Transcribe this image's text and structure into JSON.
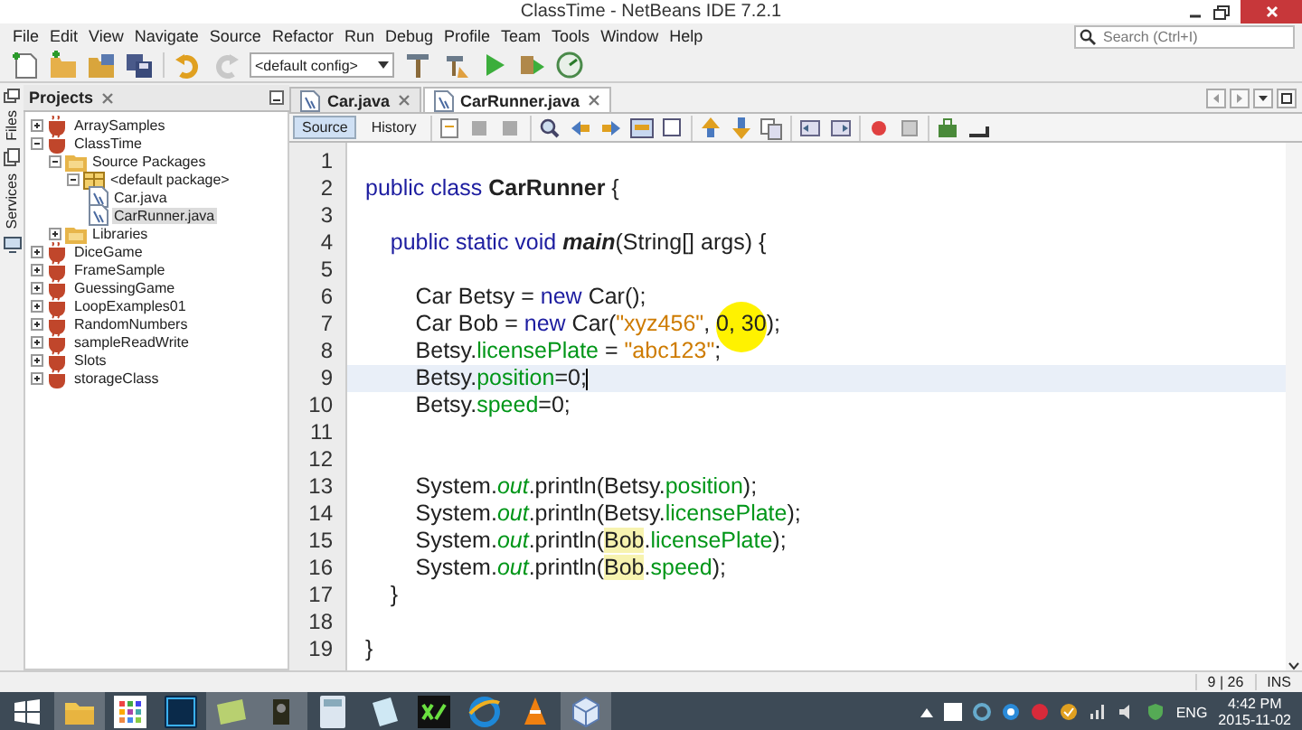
{
  "window": {
    "title": "ClassTime - NetBeans IDE 7.2.1"
  },
  "menu": [
    "File",
    "Edit",
    "View",
    "Navigate",
    "Source",
    "Refactor",
    "Run",
    "Debug",
    "Profile",
    "Team",
    "Tools",
    "Window",
    "Help"
  ],
  "toolbar": {
    "config": "<default config>"
  },
  "search": {
    "placeholder": "Search (Ctrl+I)"
  },
  "side_strip": [
    "Files",
    "Services"
  ],
  "projects_panel": {
    "title": "Projects",
    "tree": [
      {
        "label": "ArraySamples",
        "kind": "project",
        "expanded": false,
        "selected": false
      },
      {
        "label": "ClassTime",
        "kind": "project",
        "expanded": true,
        "selected": false,
        "children": [
          {
            "label": "Source Packages",
            "kind": "folder",
            "expanded": true,
            "selected": false,
            "children": [
              {
                "label": "<default package>",
                "kind": "package",
                "expanded": true,
                "selected": false,
                "children": [
                  {
                    "label": "Car.java",
                    "kind": "file",
                    "selected": false
                  },
                  {
                    "label": "CarRunner.java",
                    "kind": "file",
                    "selected": true
                  }
                ]
              }
            ]
          },
          {
            "label": "Libraries",
            "kind": "folder",
            "expanded": false,
            "selected": false
          }
        ]
      },
      {
        "label": "DiceGame",
        "kind": "project",
        "expanded": false,
        "selected": false
      },
      {
        "label": "FrameSample",
        "kind": "project",
        "expanded": false,
        "selected": false
      },
      {
        "label": "GuessingGame",
        "kind": "project",
        "expanded": false,
        "selected": false
      },
      {
        "label": "LoopExamples01",
        "kind": "project",
        "expanded": false,
        "selected": false
      },
      {
        "label": "RandomNumbers",
        "kind": "project",
        "expanded": false,
        "selected": false
      },
      {
        "label": "sampleReadWrite",
        "kind": "project",
        "expanded": false,
        "selected": false
      },
      {
        "label": "Slots",
        "kind": "project",
        "expanded": false,
        "selected": false
      },
      {
        "label": "storageClass",
        "kind": "project",
        "expanded": false,
        "selected": false
      }
    ]
  },
  "editor_tabs": [
    {
      "label": "Car.java",
      "selected": false
    },
    {
      "label": "CarRunner.java",
      "selected": true
    }
  ],
  "view_tabs": [
    {
      "label": "Source",
      "selected": true
    },
    {
      "label": "History",
      "selected": false
    }
  ],
  "code": [
    {
      "number": "1",
      "current": false
    },
    {
      "number": "2",
      "current": false,
      "segments": [
        {
          "kind": "keyword",
          "text": "public class "
        },
        {
          "kind": "declaration",
          "text": "CarRunner"
        },
        {
          "kind": "plain",
          "text": " {"
        }
      ]
    },
    {
      "number": "3",
      "current": false
    },
    {
      "number": "4",
      "current": false,
      "segments": [
        {
          "kind": "keyword",
          "text": "    public static void "
        },
        {
          "kind": "method",
          "text": "main"
        },
        {
          "kind": "plain",
          "text": "(String[] args) {"
        }
      ]
    },
    {
      "number": "5",
      "current": false
    },
    {
      "number": "6",
      "current": false,
      "segments": [
        {
          "kind": "plain",
          "text": "        Car Betsy = "
        },
        {
          "kind": "keyword",
          "text": "new"
        },
        {
          "kind": "plain",
          "text": " Car();"
        }
      ]
    },
    {
      "number": "7",
      "current": false,
      "segments": [
        {
          "kind": "plain",
          "text": "        Car Bob = "
        },
        {
          "kind": "keyword",
          "text": "new"
        },
        {
          "kind": "plain",
          "text": " Car("
        },
        {
          "kind": "string",
          "text": "\"xyz456\""
        },
        {
          "kind": "plain",
          "text": ", 0, 30);"
        }
      ]
    },
    {
      "number": "8",
      "current": false,
      "segments": [
        {
          "kind": "plain",
          "text": "        Betsy."
        },
        {
          "kind": "field",
          "text": "licensePlate"
        },
        {
          "kind": "plain",
          "text": " = "
        },
        {
          "kind": "string",
          "text": "\"abc123\""
        },
        {
          "kind": "plain",
          "text": ";"
        }
      ]
    },
    {
      "number": "9",
      "current": true,
      "segments": [
        {
          "kind": "plain",
          "text": "        Betsy."
        },
        {
          "kind": "field",
          "text": "position"
        },
        {
          "kind": "plain",
          "text": "=0;"
        }
      ]
    },
    {
      "number": "10",
      "current": false,
      "segments": [
        {
          "kind": "plain",
          "text": "        Betsy."
        },
        {
          "kind": "field",
          "text": "speed"
        },
        {
          "kind": "plain",
          "text": "=0;"
        }
      ]
    },
    {
      "number": "11",
      "current": false
    },
    {
      "number": "12",
      "current": false
    },
    {
      "number": "13",
      "current": false,
      "segments": [
        {
          "kind": "plain",
          "text": "        System."
        },
        {
          "kind": "static",
          "text": "out"
        },
        {
          "kind": "plain",
          "text": ".println(Betsy."
        },
        {
          "kind": "field",
          "text": "position"
        },
        {
          "kind": "plain",
          "text": ");"
        }
      ]
    },
    {
      "number": "14",
      "current": false,
      "segments": [
        {
          "kind": "plain",
          "text": "        System."
        },
        {
          "kind": "static",
          "text": "out"
        },
        {
          "kind": "plain",
          "text": ".println(Betsy."
        },
        {
          "kind": "field",
          "text": "licensePlate"
        },
        {
          "kind": "plain",
          "text": ");"
        }
      ]
    },
    {
      "number": "15",
      "current": false,
      "segments": [
        {
          "kind": "plain",
          "text": "        System."
        },
        {
          "kind": "static",
          "text": "out"
        },
        {
          "kind": "plain",
          "text": ".println("
        },
        {
          "kind": "occurrence",
          "text": "Bob"
        },
        {
          "kind": "plain",
          "text": "."
        },
        {
          "kind": "field",
          "text": "licensePlate"
        },
        {
          "kind": "plain",
          "text": ");"
        }
      ]
    },
    {
      "number": "16",
      "current": false,
      "segments": [
        {
          "kind": "plain",
          "text": "        System."
        },
        {
          "kind": "static",
          "text": "out"
        },
        {
          "kind": "plain",
          "text": ".println("
        },
        {
          "kind": "occurrence",
          "text": "Bob"
        },
        {
          "kind": "plain",
          "text": "."
        },
        {
          "kind": "field",
          "text": "speed"
        },
        {
          "kind": "plain",
          "text": ");"
        }
      ]
    },
    {
      "number": "17",
      "current": false,
      "segments": [
        {
          "kind": "plain",
          "text": "    }"
        }
      ]
    },
    {
      "number": "18",
      "current": false
    },
    {
      "number": "19",
      "current": false,
      "segments": [
        {
          "kind": "plain",
          "text": "}"
        }
      ]
    }
  ],
  "status_bar": {
    "position": "9 | 26",
    "mode": "INS"
  },
  "taskbar": {
    "apps": [
      {
        "kind": "explorer",
        "running": true
      },
      {
        "kind": "grid",
        "running": false
      },
      {
        "kind": "photoshop",
        "running": false
      },
      {
        "kind": "notes",
        "running": true
      },
      {
        "kind": "recorder",
        "running": true
      },
      {
        "kind": "calculator",
        "running": false
      },
      {
        "kind": "paper",
        "running": false
      },
      {
        "kind": "converter",
        "running": false
      },
      {
        "kind": "browser",
        "running": false
      },
      {
        "kind": "cone",
        "running": false
      },
      {
        "kind": "cube",
        "running": true
      }
    ],
    "language": "ENG",
    "time": "4:42 PM",
    "date": "2015-11-02"
  }
}
